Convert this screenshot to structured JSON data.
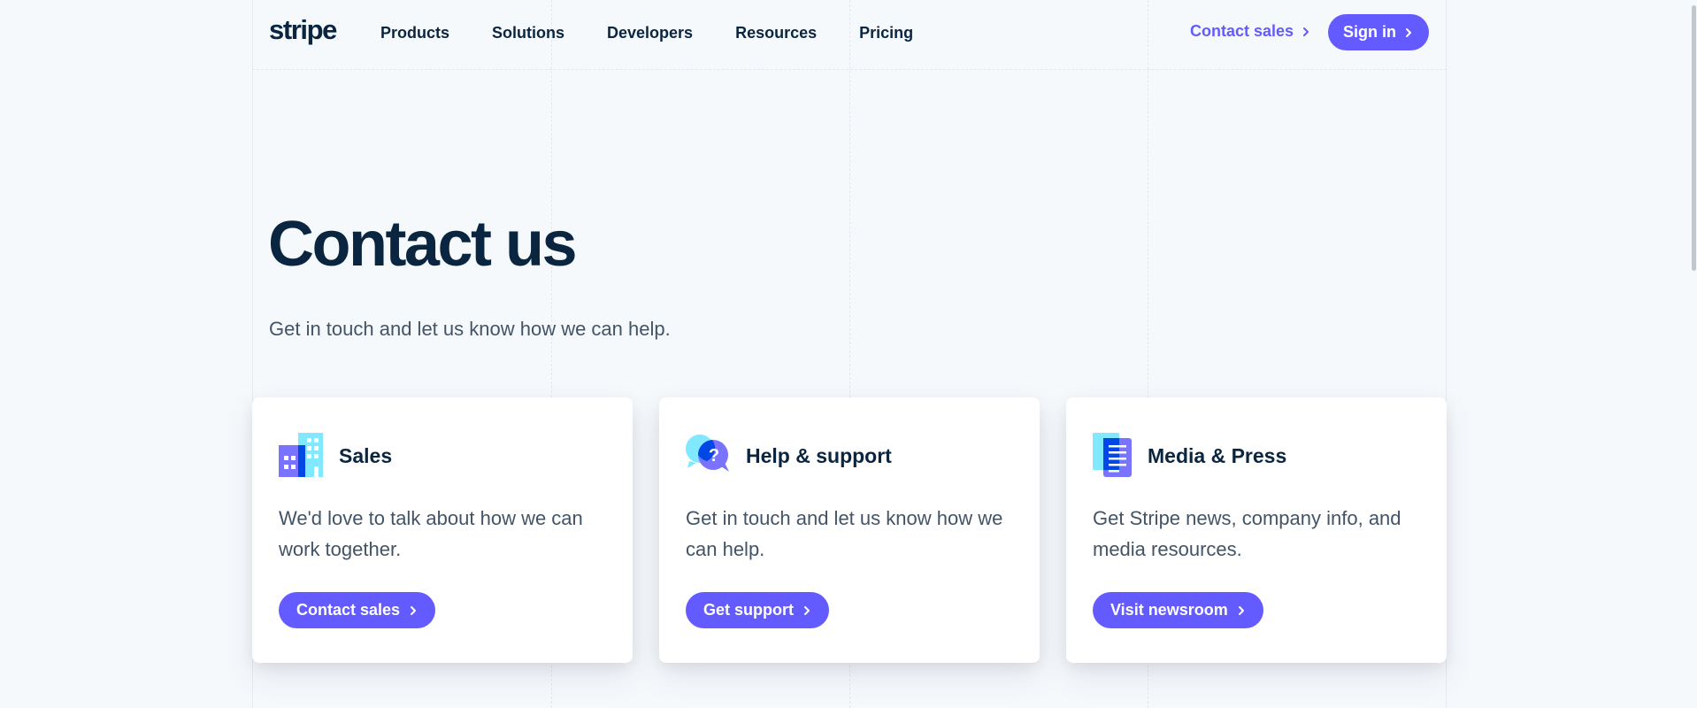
{
  "header": {
    "logo": "stripe",
    "nav": [
      "Products",
      "Solutions",
      "Developers",
      "Resources",
      "Pricing"
    ],
    "contact_sales": "Contact sales",
    "sign_in": "Sign in"
  },
  "hero": {
    "title": "Contact us",
    "subtitle": "Get in touch and let us know how we can help."
  },
  "cards": [
    {
      "icon": "building-icon",
      "title": "Sales",
      "body": "We'd love to talk about how we can work together.",
      "button": "Contact sales"
    },
    {
      "icon": "chat-question-icon",
      "title": "Help & support",
      "body": "Get in touch and let us know how we can help.",
      "button": "Get support"
    },
    {
      "icon": "document-icon",
      "title": "Media & Press",
      "body": "Get Stripe news, company info, and media resources.",
      "button": "Visit newsroom"
    }
  ],
  "colors": {
    "accent": "#635bff",
    "heading": "#0a2540",
    "body": "#425466",
    "background": "#f6f9fc"
  }
}
